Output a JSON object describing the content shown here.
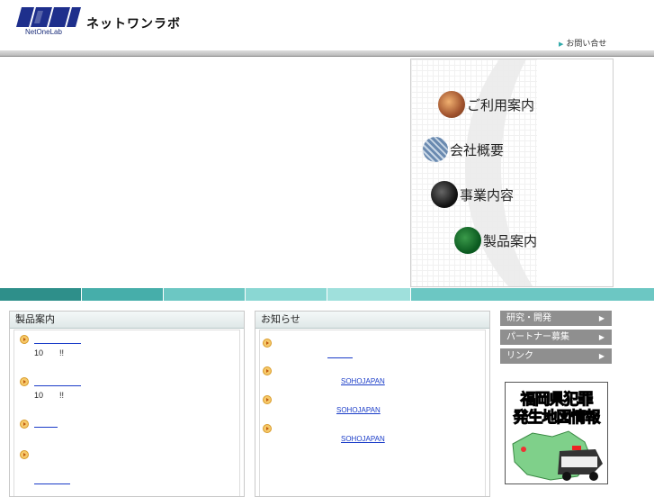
{
  "header": {
    "logo_text": "NetOneLab",
    "site_name": "ネットワンラボ",
    "contact_label": "お問い合せ"
  },
  "menu": [
    {
      "label": "ご利用案内",
      "icon": "handshake-icon"
    },
    {
      "label": "会社概要",
      "icon": "building-icon"
    },
    {
      "label": "事業内容",
      "icon": "chip-icon"
    },
    {
      "label": "製品案内",
      "icon": "circuit-board-icon"
    }
  ],
  "stripe_colors": [
    "#2e8f8a",
    "#46aeaa",
    "#6cc7c3",
    "#8ad7d3",
    "#9fe0dc",
    "#6cc7c3"
  ],
  "products": {
    "title": "製品案内",
    "item1_text": "10　　!!",
    "item2_text": "10　　!!"
  },
  "news": {
    "title": "お知らせ",
    "links": [
      "SOHOJAPAN",
      "SOHOJAPAN",
      "SOHOJAPAN"
    ]
  },
  "side_nav": [
    {
      "label": "研究・開発"
    },
    {
      "label": "パートナー募集"
    },
    {
      "label": "リンク"
    }
  ],
  "banner": {
    "line1": "福岡県犯罪",
    "line2": "発生地図情報"
  }
}
